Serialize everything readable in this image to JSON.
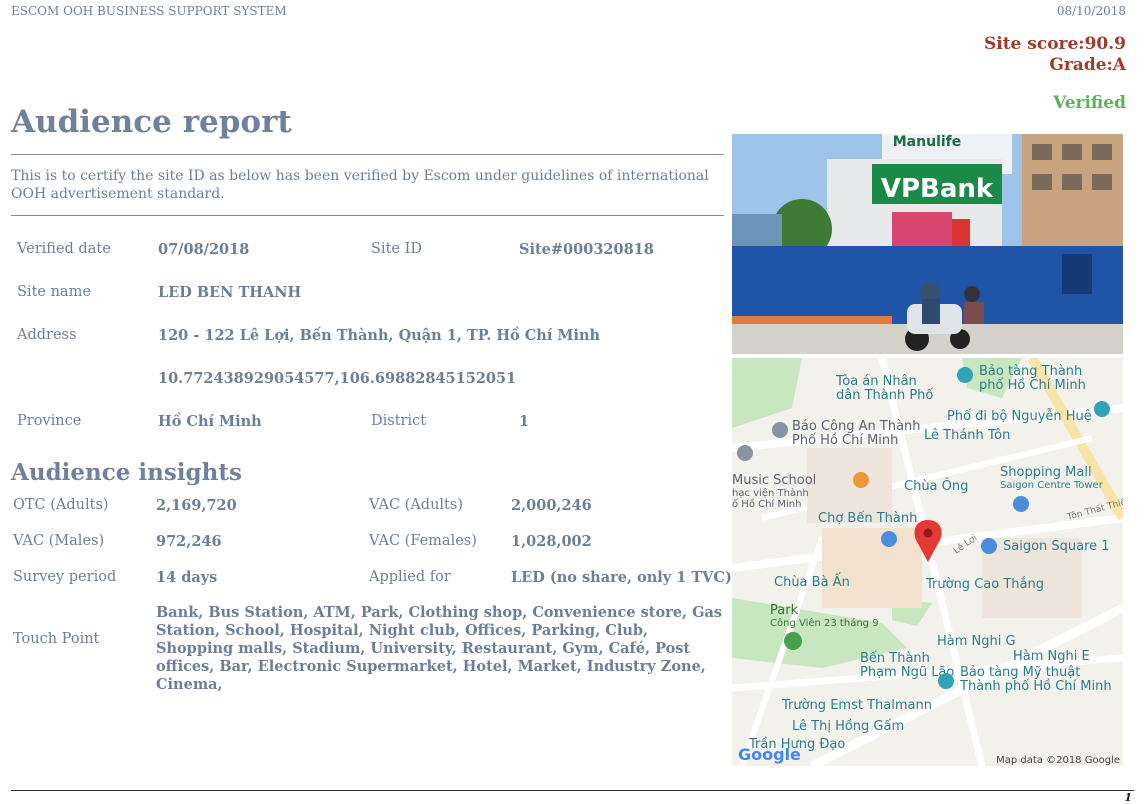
{
  "header": {
    "system_name": "ESCOM OOH BUSINESS SUPPORT SYSTEM",
    "date": "08/10/2018"
  },
  "score": {
    "site_score": "Site score:90.9",
    "grade": "Grade:A",
    "status": "Verified"
  },
  "title": "Audience report",
  "certification": "This is to certify the site ID as below has been verified by Escom under guidelines of international OOH advertisement standard.",
  "site": {
    "verified_date_label": "Verified date",
    "verified_date": "07/08/2018",
    "site_id_label": "Site ID",
    "site_id": "Site#000320818",
    "site_name_label": "Site name",
    "site_name": "LED BEN THANH",
    "address_label": "Address",
    "address": "120 - 122 Lê Lợi, Bến Thành, Quận 1, TP. Hồ Chí Minh",
    "coordinates": "10.772438929054577,106.69882845152051",
    "province_label": "Province",
    "province": "Hồ Chí Minh",
    "district_label": "District",
    "district": "1"
  },
  "insights": {
    "heading": "Audience insights",
    "otc_adults_label": "OTC (Adults)",
    "otc_adults": "2,169,720",
    "vac_adults_label": "VAC (Adults)",
    "vac_adults": "2,000,246",
    "vac_males_label": "VAC (Males)",
    "vac_males": "972,246",
    "vac_females_label": "VAC (Females)",
    "vac_females": "1,028,002",
    "survey_period_label": "Survey period",
    "survey_period": "14 days",
    "applied_for_label": "Applied for",
    "applied_for": "LED (no share, only 1 TVC)",
    "touch_point_label": "Touch Point",
    "touch_point": "Bank, Bus Station, ATM, Park, Clothing shop, Convenience store, Gas Station, School, Hospital, Night club, Offices, Parking, Club, Shopping malls, Stadium, University, Restaurant, Gym, Café, Post offices, Bar, Electronic Supermarket, Hotel, Market, Industry Zone, Cinema,"
  },
  "photo": {
    "bank_sign": "VPBank",
    "top_sign": "Manulife"
  },
  "map": {
    "labels": [
      "Bảo tàng Thành",
      "phố Hồ Chí Minh",
      "Tòa án Nhân",
      "dân Thành Phố",
      "Phố đi bộ Nguyễn Huệ",
      "Báo Công An Thành",
      "Phố Hồ Chí Minh",
      "Lê Thánh Tôn",
      "Music School",
      "hạc viện Thành",
      "ố Hồ Chí Minh",
      "Chùa Ông",
      "Shopping Mall",
      "Saigon Centre Tower",
      "Tôn Thất Thiệp",
      "Chợ Bến Thành",
      "Saigon Square 1",
      "Chùa Bà Ấn",
      "Trường Cao Thắng",
      "Park",
      "Công Viên 23 tháng 9",
      "Hàm Nghi G",
      "Hàm Nghi E",
      "Bến Thành",
      "Phạm Ngũ Lão",
      "Bảo tàng Mỹ thuật",
      "Thành phố Hồ Chí Minh",
      "Trường Emst Thalmann",
      "Lê Thị Hồng Gấm",
      "Trần Hưng Đạo",
      "Lê Lợi"
    ],
    "logo": "Google",
    "attribution": "Map data ©2018 Google"
  },
  "footer": {
    "page_number": "1"
  },
  "colors": {
    "accent": "#70829b",
    "score": "#a23a2a",
    "verified": "#5bb35a"
  }
}
